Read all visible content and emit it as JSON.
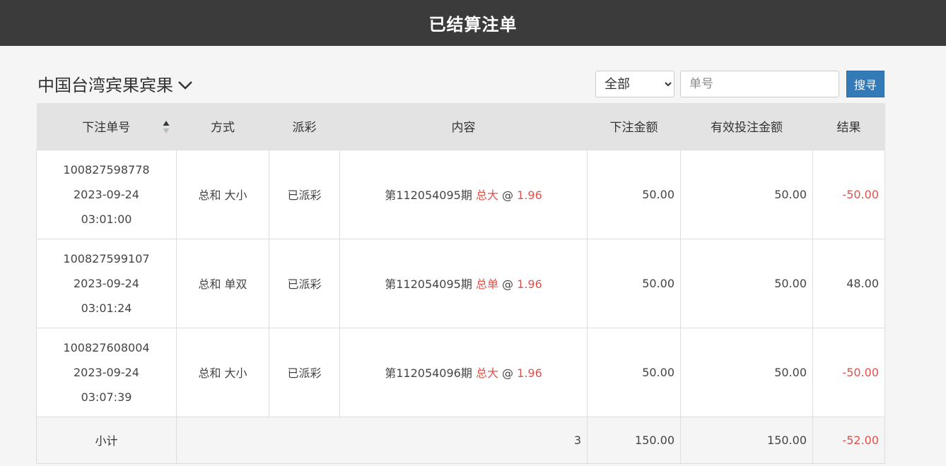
{
  "header": {
    "title": "已结算注单"
  },
  "toolbar": {
    "game_name": "中国台湾宾果宾果",
    "filter_value": "全部",
    "order_placeholder": "单号",
    "search_label": "搜寻"
  },
  "table": {
    "columns": {
      "order_no": "下注单号",
      "method": "方式",
      "payout": "派彩",
      "content": "内容",
      "bet_amount": "下注金额",
      "valid_amount": "有效投注金额",
      "result": "结果"
    },
    "rows": [
      {
        "order_no": "100827598778",
        "date": "2023-09-24",
        "time": "03:01:00",
        "method": "总和 大小",
        "payout": "已派彩",
        "period": "第112054095期",
        "pick": "总大",
        "at": "@",
        "odds": "1.96",
        "bet_amount": "50.00",
        "valid_amount": "50.00",
        "result": "-50.00"
      },
      {
        "order_no": "100827599107",
        "date": "2023-09-24",
        "time": "03:01:24",
        "method": "总和 单双",
        "payout": "已派彩",
        "period": "第112054095期",
        "pick": "总单",
        "at": "@",
        "odds": "1.96",
        "bet_amount": "50.00",
        "valid_amount": "50.00",
        "result": "48.00"
      },
      {
        "order_no": "100827608004",
        "date": "2023-09-24",
        "time": "03:07:39",
        "method": "总和 大小",
        "payout": "已派彩",
        "period": "第112054096期",
        "pick": "总大",
        "at": "@",
        "odds": "1.96",
        "bet_amount": "50.00",
        "valid_amount": "50.00",
        "result": "-50.00"
      }
    ],
    "subtotal": {
      "label": "小计",
      "count": "3",
      "bet_amount": "150.00",
      "valid_amount": "150.00",
      "result": "-52.00"
    }
  },
  "colors": {
    "header_bg": "#3b3b3b",
    "accent_red": "#d9534f",
    "button_blue": "#337ab7"
  }
}
